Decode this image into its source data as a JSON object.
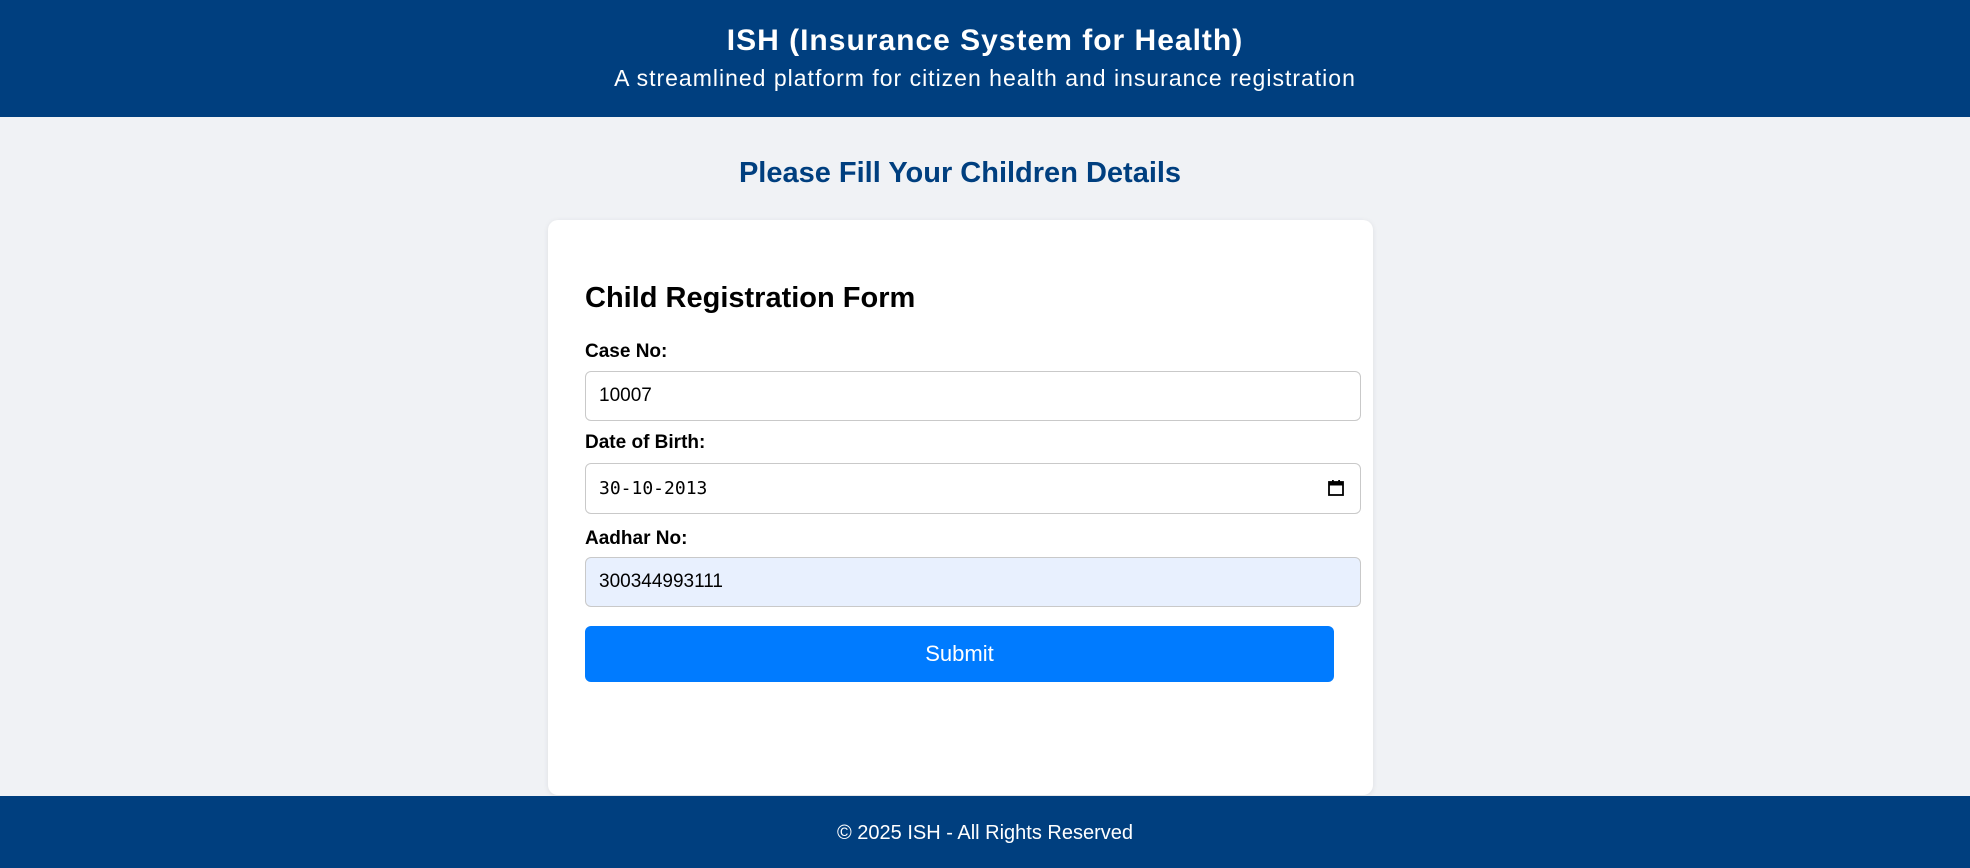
{
  "header": {
    "title": "ISH (Insurance System for Health)",
    "subtitle": "A streamlined platform for citizen health and insurance registration",
    "background_color": "#003f7f"
  },
  "page": {
    "heading": "Please Fill Your Children Details"
  },
  "form": {
    "title": "Child Registration Form",
    "case_no": {
      "label": "Case No:",
      "value": "10007"
    },
    "date_of_birth": {
      "label": "Date of Birth:",
      "value": "30-10-2013",
      "icon": "calendar-icon"
    },
    "aadhar_no": {
      "label": "Aadhar No:",
      "value": "300344993111"
    },
    "submit_label": "Submit",
    "submit_color": "#007bff"
  },
  "footer": {
    "text": "© 2025 ISH - All Rights Reserved"
  }
}
